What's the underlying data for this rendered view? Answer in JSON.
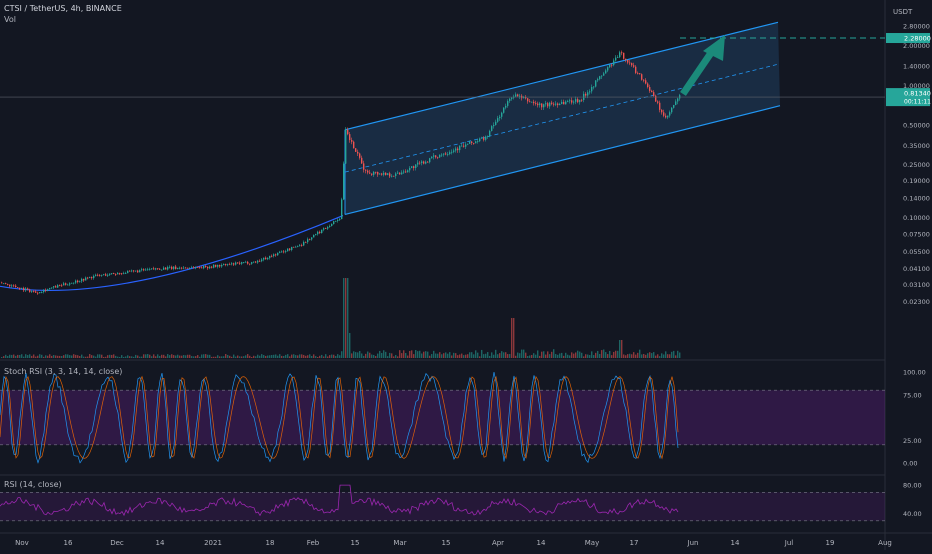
{
  "header": {
    "title": "CTSI / TetherUS, 4h, BINANCE",
    "vol_label": "Vol",
    "currency": "USDT",
    "stoch_label": "Stoch RSI (3, 3, 14, 14, close)",
    "rsi_label": "RSI (14, close)"
  },
  "price_axis": {
    "ticks": [
      "2.80000",
      "2.00000",
      "1.40000",
      "1.00000",
      "0.50000",
      "0.35000",
      "0.25000",
      "0.19000",
      "0.14000",
      "0.10000",
      "0.07500",
      "0.05500",
      "0.04100",
      "0.03100",
      "0.02300"
    ],
    "target_label": "2.28000",
    "current_price": "0.81340",
    "countdown": "00:11:11"
  },
  "stoch_axis": {
    "ticks": [
      "100.00",
      "75.00",
      "25.00",
      "0.00"
    ],
    "upper": 80,
    "lower": 20
  },
  "rsi_axis": {
    "ticks": [
      "80.00",
      "40.00"
    ],
    "upper": 70,
    "lower": 30
  },
  "time_axis": {
    "ticks": [
      "Nov",
      "16",
      "Dec",
      "14",
      "2021",
      "18",
      "Feb",
      "15",
      "Mar",
      "15",
      "Apr",
      "14",
      "May",
      "17",
      "Jun",
      "14",
      "Jul",
      "19",
      "Aug"
    ]
  },
  "colors": {
    "background": "#131722",
    "up": "#26a69a",
    "down": "#ef5350",
    "channel": "#2196f3",
    "channel_fill": "#1e3a5a",
    "arc": "#2962ff",
    "target": "#26a69a",
    "arrow": "#1b8a7a",
    "stoch_k": "#2196f3",
    "stoch_d": "#ff6d00",
    "rsi_line": "#9c27b0",
    "band": "#7b1fa2"
  },
  "chart_data": {
    "type": "candlestick",
    "title": "CTSI / TetherUS, 4h, BINANCE",
    "scale": "log",
    "ylim": [
      0.02,
      2.9
    ],
    "x_ticks": [
      "Nov",
      "16",
      "Dec",
      "14",
      "2021",
      "18",
      "Feb",
      "15",
      "Mar",
      "15",
      "Apr",
      "14",
      "May",
      "17",
      "Jun",
      "14",
      "Jul",
      "19",
      "Aug"
    ],
    "price_path": [
      [
        "Nov",
        0.032
      ],
      [
        "16",
        0.027
      ],
      [
        "Dec",
        0.036
      ],
      [
        "14",
        0.041
      ],
      [
        "2021",
        0.042
      ],
      [
        "18",
        0.046
      ],
      [
        "Feb",
        0.062
      ],
      [
        "Feb 10",
        0.1
      ],
      [
        "Feb 11",
        0.45
      ],
      [
        "15",
        0.22
      ],
      [
        "Mar",
        0.21
      ],
      [
        "15",
        0.3
      ],
      [
        "Apr",
        0.4
      ],
      [
        "Apr 9",
        0.85
      ],
      [
        "14",
        0.7
      ],
      [
        "May",
        0.78
      ],
      [
        "May 10",
        1.75
      ],
      [
        "17",
        1.05
      ],
      [
        "May 24",
        0.55
      ],
      [
        "May 27",
        0.8134
      ]
    ],
    "current_price": 0.8134,
    "target_price": 2.28,
    "indicators": {
      "stoch_rsi": {
        "params": "3, 3, 14, 14, close",
        "ylim": [
          0,
          100
        ],
        "bands": [
          20,
          80
        ]
      },
      "rsi": {
        "params": "14, close",
        "bands": [
          30,
          70
        ]
      }
    }
  }
}
